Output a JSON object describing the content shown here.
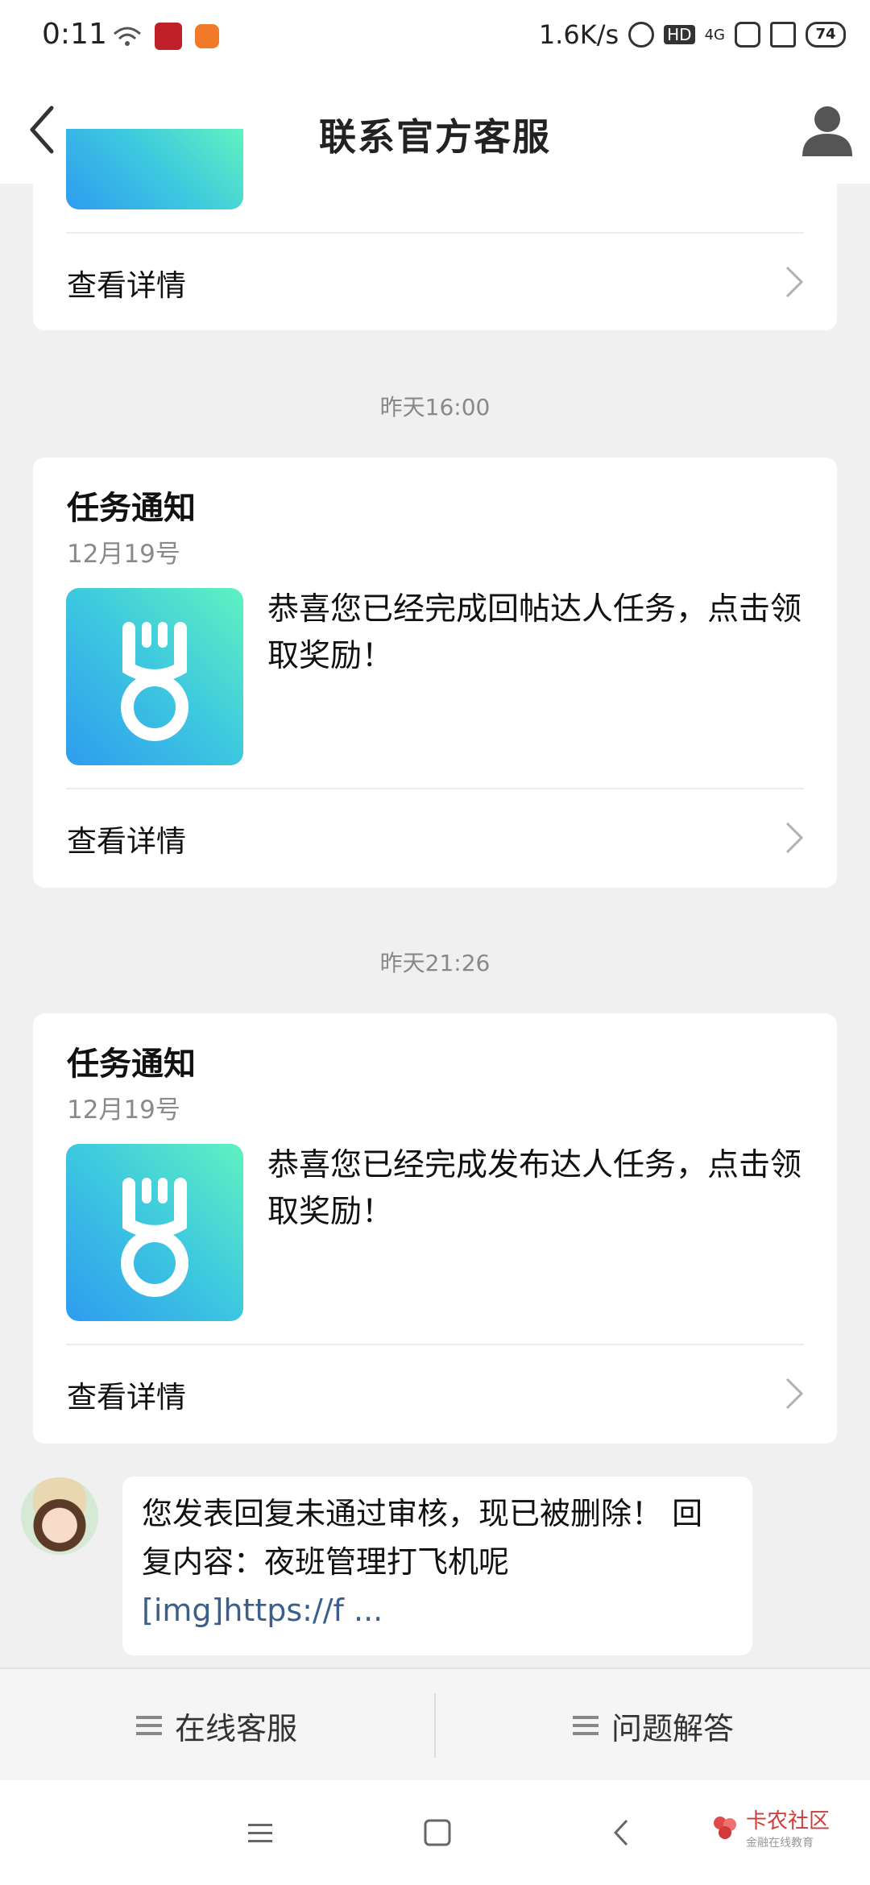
{
  "status_bar": {
    "time": "0:11",
    "net_speed": "1.6K/s",
    "hd": "HD",
    "network": "4G",
    "battery": "74"
  },
  "header": {
    "title": "联系官方客服"
  },
  "cards": [
    {
      "detail_label": "查看详情"
    },
    {
      "time": "昨天16:00",
      "title": "任务通知",
      "date": "12月19号",
      "text": "恭喜您已经完成回帖达人任务，点击领取奖励！",
      "detail_label": "查看详情"
    },
    {
      "time": "昨天21:26",
      "title": "任务通知",
      "date": "12月19号",
      "text": "恭喜您已经完成发布达人任务，点击领取奖励！",
      "detail_label": "查看详情"
    }
  ],
  "chat": {
    "message": "您发表回复未通过审核，现已被删除！ 回复内容：夜班管理打飞机呢",
    "link": "[img]https://f ..."
  },
  "bottom_menu": {
    "left": "在线客服",
    "right": "问题解答"
  },
  "watermark": {
    "brand": "卡农社区",
    "sub": "金融在线教育"
  },
  "colors": {
    "thumb_gradient_start": "#5ff2c0",
    "thumb_gradient_end": "#2e9cf0",
    "link": "#3a5f8c"
  }
}
